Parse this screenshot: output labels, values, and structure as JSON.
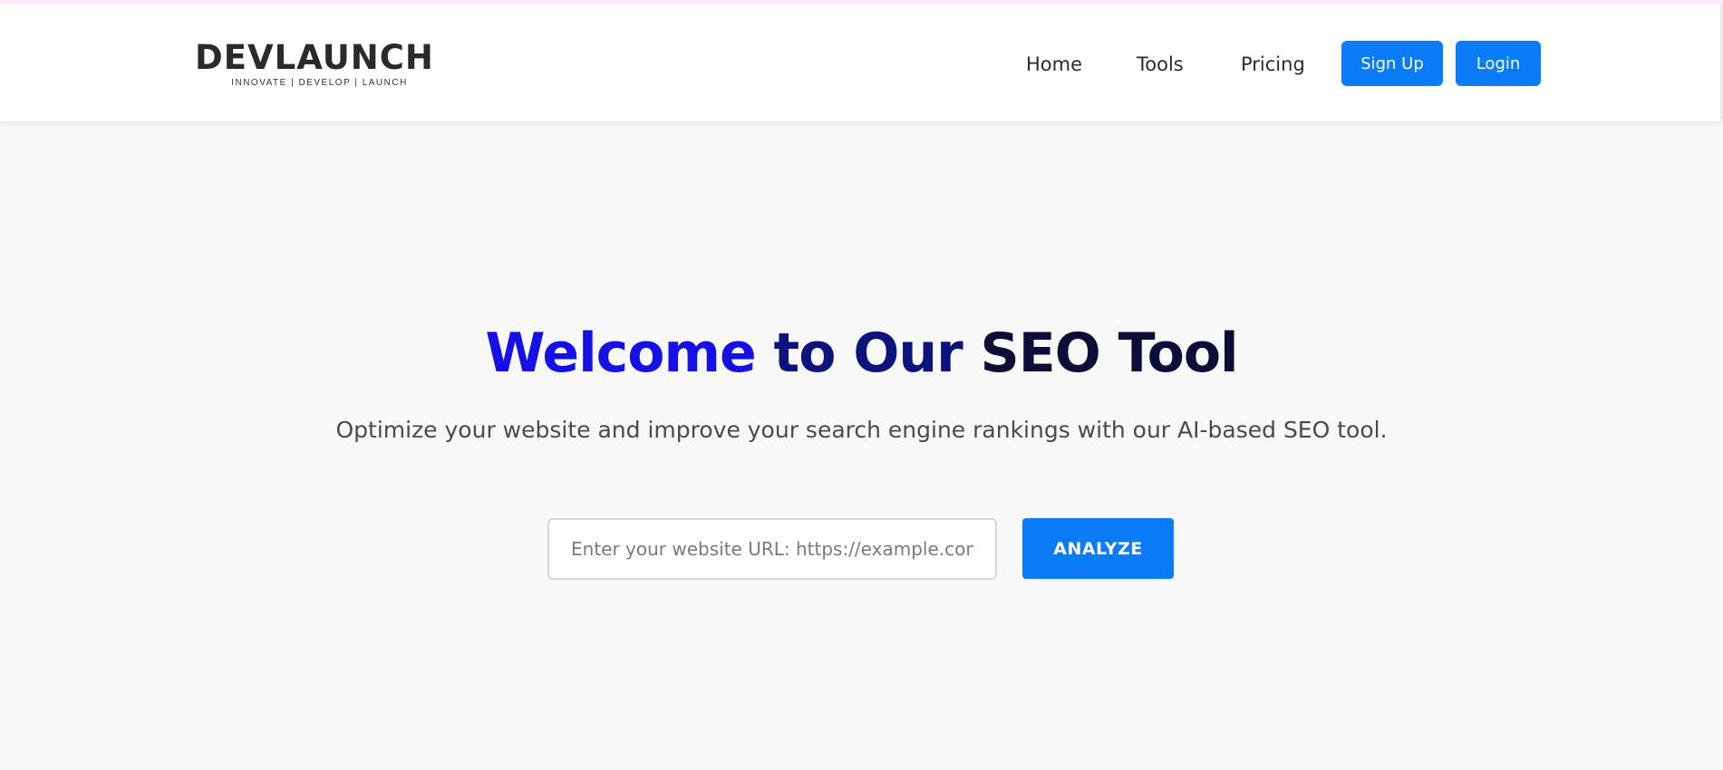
{
  "header": {
    "logo": {
      "wordmark": "DEVLAUNCH",
      "tagline": "INNOVATE | DEVELOP | LAUNCH"
    },
    "nav": [
      {
        "label": "Home"
      },
      {
        "label": "Tools"
      },
      {
        "label": "Pricing"
      }
    ],
    "signup_label": "Sign Up",
    "login_label": "Login"
  },
  "hero": {
    "title_part1": "Welcome",
    "title_part2": " to Our",
    "title_part3": " SEO Tool",
    "subtitle": "Optimize your website and improve your search engine rankings with our AI-based SEO tool.",
    "url_placeholder": "Enter your website URL: https://example.com",
    "url_value": "",
    "analyze_label": "ANALYZE"
  },
  "colors": {
    "brand_blue": "#0a7cf7",
    "title_blue": "#1410e6",
    "title_navy": "#0c127e",
    "title_dark": "#0d0d3a",
    "background": "#f8f8f8"
  }
}
